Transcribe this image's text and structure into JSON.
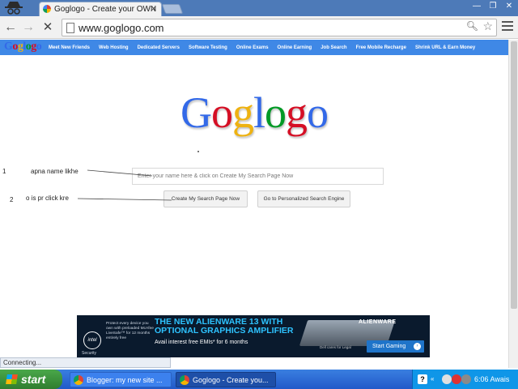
{
  "browser": {
    "tab_title": "Goglogo - Create your OWN",
    "url": "www.goglogo.com"
  },
  "site": {
    "logo_text": "Goglogo",
    "nav_links": [
      "Meet New Friends",
      "Web Hosting",
      "Dedicated Servers",
      "Software Testing",
      "Online Exams",
      "Online Earning",
      "Job Search",
      "Free Mobile Recharge",
      "Shrink URL & Earn Money"
    ],
    "big_logo": "Goglogo",
    "search_placeholder": "Enter your name here & click on Create My Search Page Now",
    "button_create": "Create My Search Page Now",
    "button_personalized": "Go to Personalized Search Engine"
  },
  "annotations": [
    {
      "num": "1",
      "text": "apna name likhe"
    },
    {
      "num": "2",
      "text": "o is pr click kre"
    }
  ],
  "ad": {
    "left_text": "Protect every device you own with preloaded McAfee LiveSafe™ for 12 months entirely free",
    "intel_label": "intel",
    "security_label": "Security",
    "headline_1": "THE NEW ALIENWARE 13 WITH",
    "headline_2": "OPTIONAL GRAPHICS AMPLIFIER",
    "sub": "Avail interest free EMIs* for 6 months",
    "brand": "ALIENWARE",
    "dell_text": "Dell cares for Legal",
    "cta": "Start Gaming"
  },
  "status_text": "Connecting...",
  "taskbar": {
    "start_label": "start",
    "tasks": [
      "Blogger: my new site ...",
      "Goglogo - Create you..."
    ],
    "clock": "6:06 Awais"
  },
  "colors": {
    "logo": [
      "#3369e8",
      "#d50f25",
      "#eeb211",
      "#3369e8",
      "#009925",
      "#d50f25",
      "#3369e8"
    ],
    "nav_bar": "#3f88e6"
  }
}
